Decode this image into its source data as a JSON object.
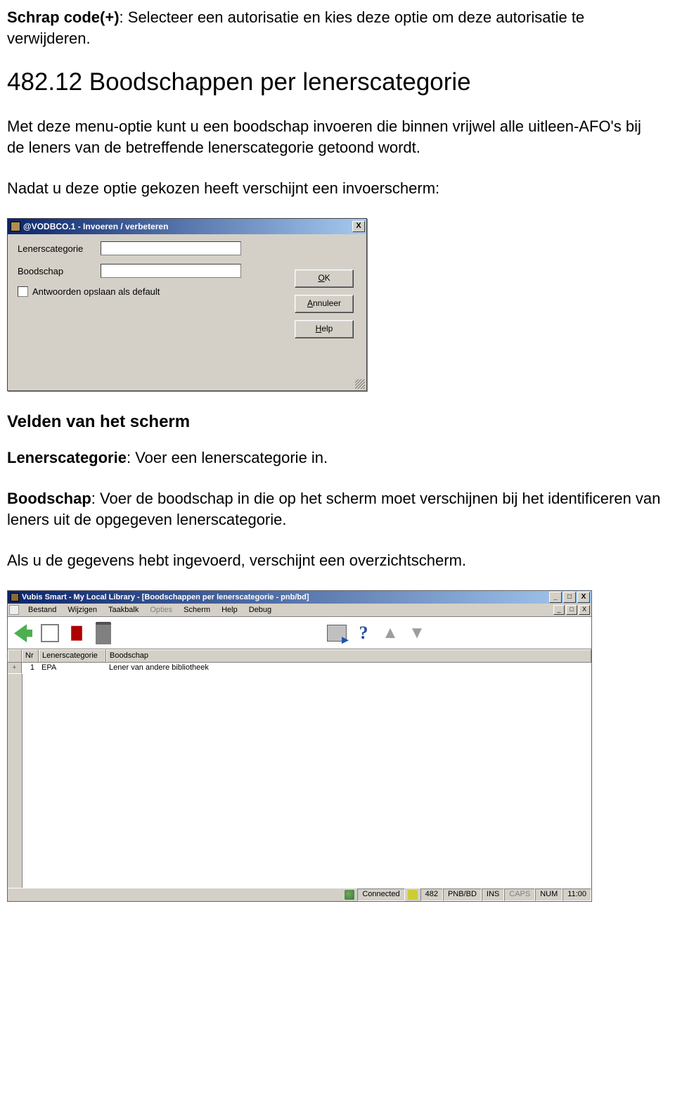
{
  "doc": {
    "p1_bold": "Schrap code(+)",
    "p1_rest": ": Selecteer een autorisatie en kies deze optie om deze autorisatie te verwijderen.",
    "heading": "482.12 Boodschappen per lenerscategorie",
    "p2": "Met deze menu-optie kunt u een boodschap invoeren die binnen vrijwel alle uitleen-AFO's bij de leners van de betreffende lenerscategorie getoond wordt.",
    "p3": "Nadat u deze optie gekozen heeft verschijnt een invoerscherm:",
    "h2": "Velden van het scherm",
    "p4_bold": "Lenerscategorie",
    "p4_rest": ": Voer een lenerscategorie in.",
    "p5_bold": "Boodschap",
    "p5_rest": ": Voer de boodschap in die op het scherm moet verschijnen bij het identificeren van leners uit de opgegeven lenerscategorie.",
    "p6": "Als u de gegevens hebt ingevoerd, verschijnt een overzichtscherm."
  },
  "dialog": {
    "title": "@VODBCO.1 - Invoeren / verbeteren",
    "close": "X",
    "labels": {
      "lenerscategorie": "Lenerscategorie",
      "boodschap": "Boodschap",
      "checkbox_prefix": "A",
      "checkbox_rest": "ntwoorden opslaan als default"
    },
    "fields": {
      "lenerscategorie_value": "",
      "boodschap_value": ""
    },
    "buttons": {
      "ok_u": "O",
      "ok_rest": "K",
      "cancel_u": "A",
      "cancel_rest": "nnuleer",
      "help_u": "H",
      "help_rest": "elp"
    }
  },
  "app": {
    "title": "Vubis Smart - My Local Library - [Boodschappen per lenerscategorie - pnb/bd]",
    "menu": {
      "bestand": "Bestand",
      "wijzigen": "Wijzigen",
      "taakbalk": "Taakbalk",
      "opties": "Opties",
      "scherm": "Scherm",
      "help": "Help",
      "debug": "Debug"
    },
    "sysbtns": {
      "min": "_",
      "max": "□",
      "close": "X"
    },
    "columns": {
      "nr": "Nr",
      "lenerscategorie": "Lenerscategorie",
      "boodschap": "Boodschap"
    },
    "rows": [
      {
        "marker": "+",
        "nr": "1",
        "cat": "EPA",
        "msg": "Lener van andere bibliotheek"
      }
    ],
    "status": {
      "connected": "Connected",
      "afo": "482",
      "inst": "PNB/BD",
      "ins": "INS",
      "caps": "CAPS",
      "num": "NUM",
      "time": "11:00"
    }
  }
}
